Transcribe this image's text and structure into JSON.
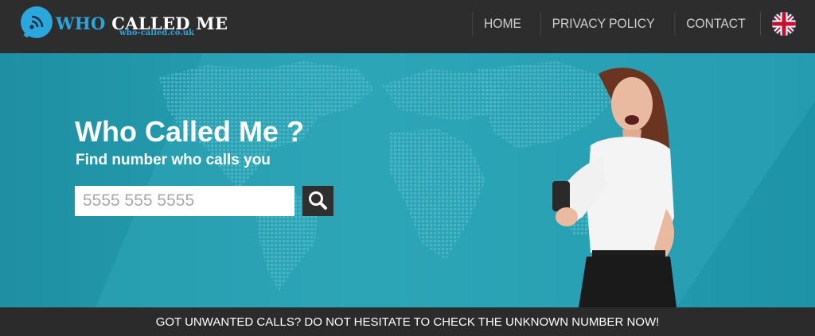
{
  "header": {
    "logo_text_who": "WHO",
    "logo_text_rest": "CALLED ME",
    "logo_domain": "who-called.co.uk",
    "nav": [
      {
        "label": "HOME",
        "name": "nav-home"
      },
      {
        "label": "PRIVACY POLICY",
        "name": "nav-privacy-policy"
      },
      {
        "label": "CONTACT",
        "name": "nav-contact"
      }
    ],
    "language_icon": "uk-flag-icon"
  },
  "hero": {
    "title": "Who Called Me ?",
    "subtitle": "Find number who calls you",
    "search_placeholder": "5555 555 5555",
    "search_icon": "search-icon"
  },
  "footer": {
    "banner": "GOT UNWANTED CALLS? DO NOT HESITATE TO CHECK THE UNKNOWN NUMBER NOW!"
  },
  "colors": {
    "accent": "#2aa7dc",
    "hero_bg": "#29a3b5",
    "bar_bg": "#2d2d2d"
  }
}
